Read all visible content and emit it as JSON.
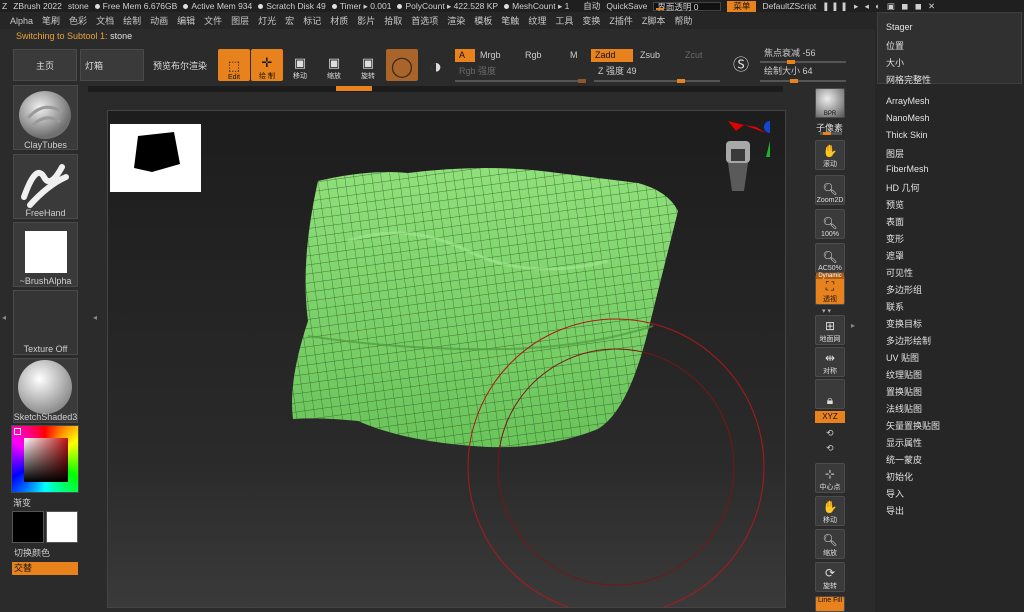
{
  "titlebar": {
    "app": "ZBrush 2022",
    "doc": "stone",
    "free_mem": "Free Mem 6.676GB",
    "active_mem": "Active Mem 934",
    "scratch": "Scratch Disk 49",
    "timer": "Timer ▸ 0.001",
    "polycount": "PolyCount ▸ 422.528 KP",
    "meshcount": "MeshCount ▸ 1",
    "auto": "自动",
    "quicksave": "QuickSave",
    "ui_opacity": "界面透明 0",
    "menu_btn": "菜单",
    "zscript": "DefaultZScript"
  },
  "menubar": [
    "Alpha",
    "笔刷",
    "色彩",
    "文档",
    "绘制",
    "动画",
    "编辑",
    "文件",
    "图层",
    "灯光",
    "宏",
    "标记",
    "材质",
    "影片",
    "拾取",
    "首选项",
    "渲染",
    "模板",
    "笔触",
    "纹理",
    "工具",
    "变换",
    "Z插件",
    "Z脚本",
    "帮助"
  ],
  "status": {
    "label": "Switching to Subtool 1:",
    "name": "stone"
  },
  "toolbar": {
    "home": "主页",
    "lightbox": "灯箱",
    "bool_preview": "预览布尔渲染",
    "edit": "Edit",
    "draw": "绘 制",
    "move": "移动",
    "scale": "缩放",
    "rotate": "旋转",
    "a_btn": "A",
    "mrgb": "Mrgb",
    "rgb": "Rgb",
    "m": "M",
    "zadd": "Zadd",
    "zsub": "Zsub",
    "zcut": "Zcut",
    "rgb_intensity": "Rgb 强度",
    "z_intensity": "Z 强度 49",
    "focal_label": "焦点衰减",
    "focal_value": "-56",
    "draw_size_label": "绘制大小",
    "draw_size_value": "64"
  },
  "leftshelf": {
    "brush": "ClayTubes",
    "stroke": "FreeHand",
    "alpha": "~BrushAlpha",
    "texture": "Texture Off",
    "material": "SketchShaded3",
    "gradient": "渐变",
    "switch_color": "切换颜色",
    "alternate": "交替"
  },
  "rightcol": {
    "bpr": "BPR",
    "subpixel": "子像素",
    "scroll": "滚动",
    "zoom2d": "Zoom2D",
    "z100": "100%",
    "ac50": "AC50%",
    "dynamic": "Dynamic",
    "persp": "透视",
    "floor": "地面网",
    "local": "对称",
    "xyz": "XYZ",
    "center": "中心点",
    "move": "移动",
    "zoom": "缩放",
    "rotate": "旋转",
    "linefill": "Line Fill"
  },
  "rightpanel": {
    "header_items": [
      "Stager",
      "位置",
      "大小",
      "网格完整性"
    ],
    "items": [
      "ArrayMesh",
      "NanoMesh",
      "Thick Skin",
      "图层",
      "FiberMesh",
      "HD 几何",
      "预览",
      "表面",
      "变形",
      "遮罩",
      "可见性",
      "多边形组",
      "联系",
      "变换目标",
      "多边形绘制",
      "UV 贴图",
      "纹理贴图",
      "置换贴图",
      "法线贴图",
      "矢量置换贴图",
      "显示属性",
      "统一蒙皮",
      "初始化",
      "导入",
      "导出"
    ]
  },
  "colors": {
    "accent": "#e8821c",
    "mesh": "#7fd36b",
    "brush_ring": "#b01818"
  }
}
